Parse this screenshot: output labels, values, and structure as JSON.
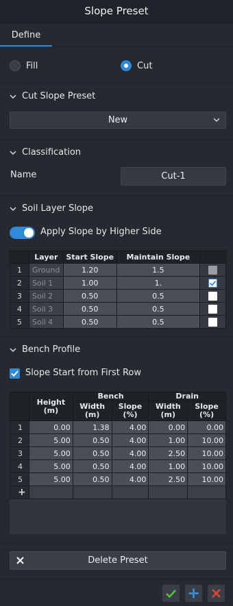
{
  "window": {
    "title": "Slope Preset"
  },
  "tabs": [
    {
      "label": "Define"
    }
  ],
  "mode": {
    "fill_label": "Fill",
    "cut_label": "Cut",
    "selected": "Cut"
  },
  "preset_section": {
    "title": "Cut Slope Preset",
    "selected": "New"
  },
  "classification": {
    "title": "Classification",
    "name_label": "Name",
    "name_value": "Cut-1"
  },
  "soil_layer": {
    "title": "Soil Layer Slope",
    "toggle_label": "Apply Slope by Higher Side",
    "toggle_on": true,
    "columns": [
      "",
      "Layer",
      "Start Slope",
      "Maintain Slope",
      ""
    ],
    "rows": [
      {
        "n": "1",
        "layer": "Ground",
        "start": "1.20",
        "maintain": "1.5",
        "checked": false,
        "disabled": true
      },
      {
        "n": "2",
        "layer": "Soil 1",
        "start": "1.00",
        "maintain": "1.",
        "checked": true,
        "disabled": false
      },
      {
        "n": "3",
        "layer": "Soil 2",
        "start": "0.50",
        "maintain": "0.5",
        "checked": false,
        "disabled": false
      },
      {
        "n": "4",
        "layer": "Soil 3",
        "start": "0.50",
        "maintain": "0.5",
        "checked": false,
        "disabled": false
      },
      {
        "n": "5",
        "layer": "Soil 4",
        "start": "0.50",
        "maintain": "0.5",
        "checked": false,
        "disabled": false
      }
    ]
  },
  "bench_profile": {
    "title": "Bench Profile",
    "first_row_label": "Slope Start from First Row",
    "first_row_checked": true,
    "headers": {
      "height": "Height\n(m)",
      "bench": "Bench",
      "drain": "Drain",
      "bench_width": "Width\n(m)",
      "bench_slope": "Slope\n(%)",
      "drain_width": "Width\n(m)",
      "drain_slope": "Slope\n(%)"
    },
    "rows": [
      {
        "n": "1",
        "height": "0.00",
        "bw": "1.38",
        "bs": "4.00",
        "dw": "0.00",
        "ds": "0.00"
      },
      {
        "n": "2",
        "height": "5.00",
        "bw": "0.50",
        "bs": "4.00",
        "dw": "1.00",
        "ds": "10.00"
      },
      {
        "n": "3",
        "height": "5.00",
        "bw": "0.50",
        "bs": "4.00",
        "dw": "2.50",
        "ds": "10.00"
      },
      {
        "n": "4",
        "height": "5.00",
        "bw": "0.50",
        "bs": "4.00",
        "dw": "1.00",
        "ds": "10.00"
      },
      {
        "n": "5",
        "height": "5.00",
        "bw": "0.50",
        "bs": "4.00",
        "dw": "2.50",
        "ds": "10.00"
      }
    ],
    "add_row_symbol": "+"
  },
  "delete_button": {
    "label": "Delete Preset"
  },
  "footer": {
    "ok_icon": "check-icon",
    "add_icon": "plus-icon",
    "cancel_icon": "close-icon"
  },
  "colors": {
    "accent": "#2f8ad8",
    "ok": "#5bbf3a",
    "cancel": "#e0463c"
  }
}
